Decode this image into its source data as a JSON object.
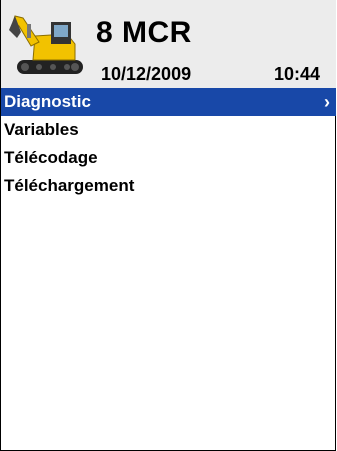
{
  "header": {
    "model": "8 MCR",
    "date": "10/12/2009",
    "time": "10:44",
    "logo_icon": "excavator-icon"
  },
  "menu": {
    "items": [
      {
        "label": "Diagnostic",
        "selected": true
      },
      {
        "label": "Variables",
        "selected": false
      },
      {
        "label": "Télécodage",
        "selected": false
      },
      {
        "label": "Téléchargement",
        "selected": false
      }
    ],
    "chevron": "›"
  },
  "colors": {
    "selection": "#1848a8",
    "header_bg": "#ececec",
    "machine_yellow": "#f2c200"
  }
}
